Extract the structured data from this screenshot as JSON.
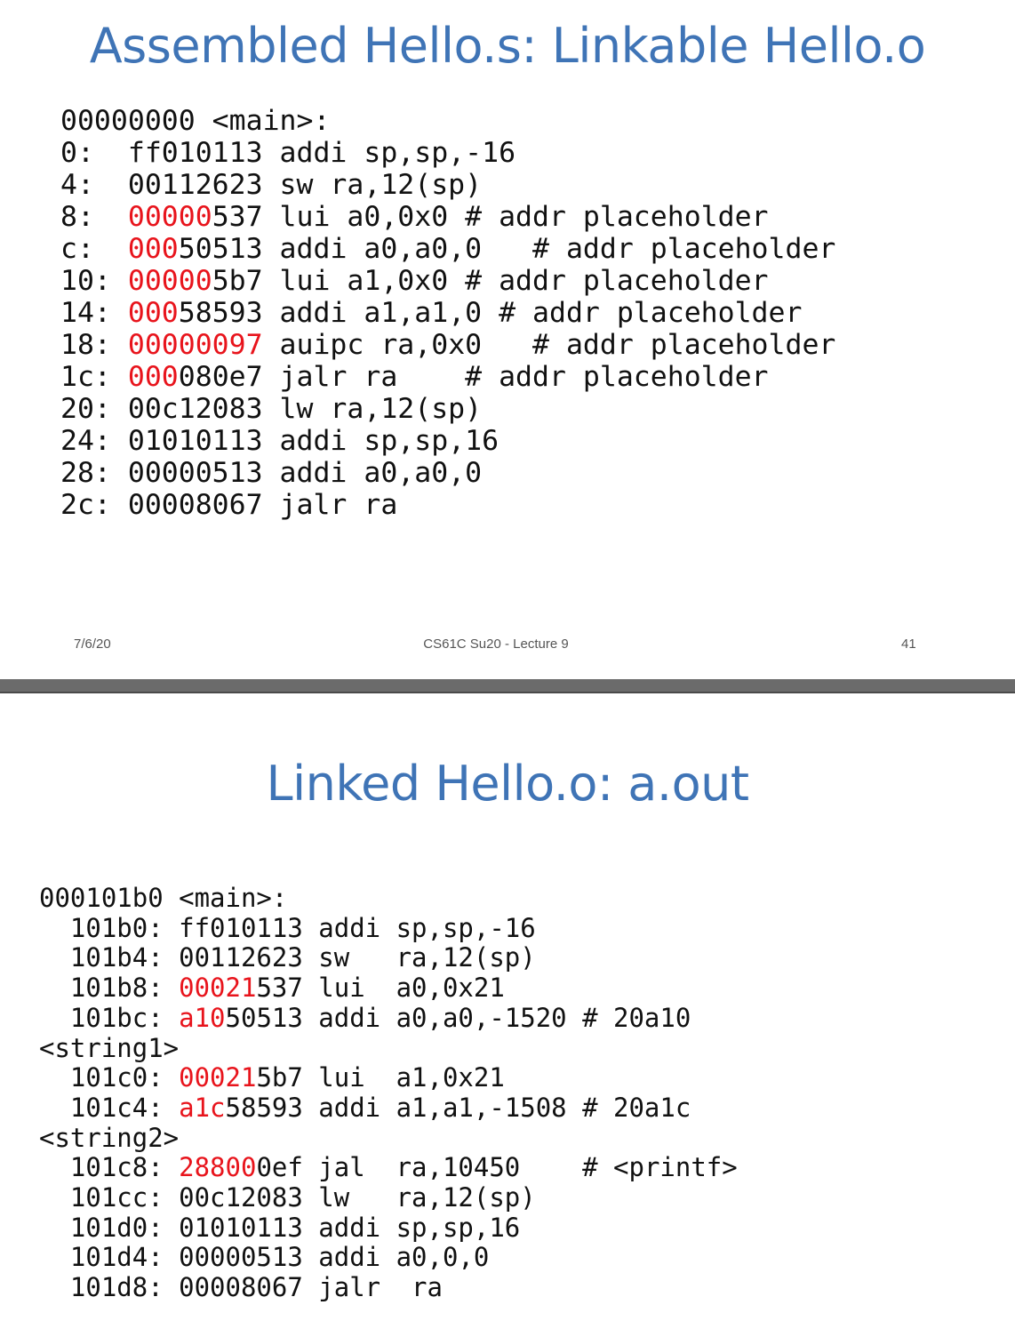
{
  "slide1": {
    "title": "Assembled Hello.s: Linkable Hello.o",
    "code": [
      [
        {
          "t": "00000000 <main>:"
        }
      ],
      [
        {
          "t": "0:  ff010113 addi sp,sp,-16"
        }
      ],
      [
        {
          "t": "4:  00112623 sw ra,12(sp)"
        }
      ],
      [
        {
          "t": "8:  "
        },
        {
          "t": "00000",
          "red": true
        },
        {
          "t": "537 lui a0,0x0 # addr placeholder"
        }
      ],
      [
        {
          "t": "c:  "
        },
        {
          "t": "000",
          "red": true
        },
        {
          "t": "50513 addi a0,a0,0   # addr placeholder"
        }
      ],
      [
        {
          "t": "10: "
        },
        {
          "t": "00000",
          "red": true
        },
        {
          "t": "5b7 lui a1,0x0 # addr placeholder"
        }
      ],
      [
        {
          "t": "14: "
        },
        {
          "t": "000",
          "red": true
        },
        {
          "t": "58593 addi a1,a1,0 # addr placeholder"
        }
      ],
      [
        {
          "t": "18: "
        },
        {
          "t": "00000097",
          "red": true
        },
        {
          "t": " auipc ra,0x0   # addr placeholder"
        }
      ],
      [
        {
          "t": "1c: "
        },
        {
          "t": "000",
          "red": true
        },
        {
          "t": "080e7 jalr ra    # addr placeholder"
        }
      ],
      [
        {
          "t": "20: 00c12083 lw ra,12(sp)"
        }
      ],
      [
        {
          "t": "24: 01010113 addi sp,sp,16"
        }
      ],
      [
        {
          "t": "28: 00000513 addi a0,a0,0"
        }
      ],
      [
        {
          "t": "2c: 00008067 jalr ra"
        }
      ]
    ],
    "footer": {
      "date": "7/6/20",
      "course": "CS61C Su20 - Lecture 9",
      "page": "41"
    }
  },
  "slide2": {
    "title": "Linked Hello.o: a.out",
    "code": [
      [
        {
          "t": "000101b0 <main>:"
        }
      ],
      [
        {
          "t": "  101b0: ff010113 addi sp,sp,-16"
        }
      ],
      [
        {
          "t": "  101b4: 00112623 sw   ra,12(sp)"
        }
      ],
      [
        {
          "t": "  101b8: "
        },
        {
          "t": "00021",
          "red": true
        },
        {
          "t": "537 lui  a0,0x21"
        }
      ],
      [
        {
          "t": "  101bc: "
        },
        {
          "t": "a10",
          "red": true
        },
        {
          "t": "50513 addi a0,a0,-1520 # 20a10"
        }
      ],
      [
        {
          "t": "<string1>"
        }
      ],
      [
        {
          "t": "  101c0: "
        },
        {
          "t": "00021",
          "red": true
        },
        {
          "t": "5b7 lui  a1,0x21"
        }
      ],
      [
        {
          "t": "  101c4: "
        },
        {
          "t": "a1c",
          "red": true
        },
        {
          "t": "58593 addi a1,a1,-1508 # 20a1c"
        }
      ],
      [
        {
          "t": "<string2>"
        }
      ],
      [
        {
          "t": "  101c8: "
        },
        {
          "t": "28800",
          "red": true
        },
        {
          "t": "0ef jal  ra,10450    # <printf>"
        }
      ],
      [
        {
          "t": "  101cc: 00c12083 lw   ra,12(sp)"
        }
      ],
      [
        {
          "t": "  101d0: 01010113 addi sp,sp,16"
        }
      ],
      [
        {
          "t": "  101d4: 00000513 addi a0,0,0"
        }
      ],
      [
        {
          "t": "  101d8: 00008067 jalr  ra"
        }
      ]
    ]
  }
}
